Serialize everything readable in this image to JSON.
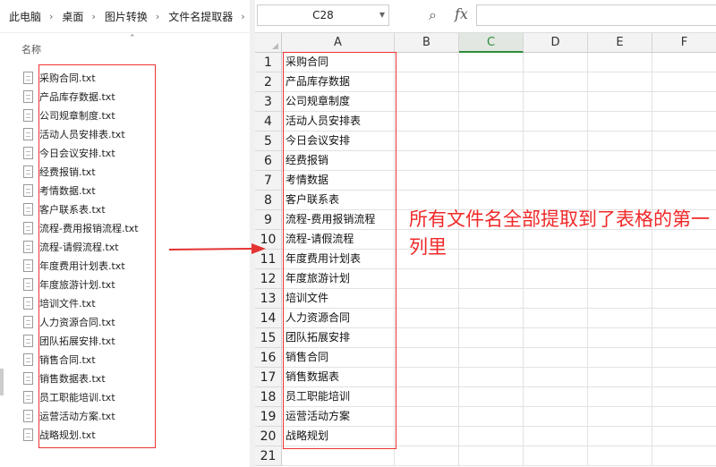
{
  "explorer": {
    "breadcrumb": [
      "此电脑",
      "桌面",
      "图片转换",
      "文件名提取器"
    ],
    "column_header": "名称",
    "files": [
      "采购合同.txt",
      "产品库存数据.txt",
      "公司规章制度.txt",
      "活动人员安排表.txt",
      "今日会议安排.txt",
      "经费报销.txt",
      "考情数据.txt",
      "客户联系表.txt",
      "流程-费用报销流程.txt",
      "流程-请假流程.txt",
      "年度费用计划表.txt",
      "年度旅游计划.txt",
      "培训文件.txt",
      "人力资源合同.txt",
      "团队拓展安排.txt",
      "销售合同.txt",
      "销售数据表.txt",
      "员工职能培训.txt",
      "运营活动方案.txt",
      "战略规划.txt"
    ]
  },
  "sheet": {
    "name_box": "C28",
    "fx_label": "fx",
    "columns": [
      "A",
      "B",
      "C",
      "D",
      "E",
      "F"
    ],
    "active_column": "C",
    "row_numbers": [
      "1",
      "2",
      "3",
      "4",
      "5",
      "6",
      "7",
      "8",
      "9",
      "10",
      "11",
      "12",
      "13",
      "14",
      "15",
      "16",
      "17",
      "18",
      "19",
      "20",
      "21"
    ],
    "column_a": [
      "采购合同",
      "产品库存数据",
      "公司规章制度",
      "活动人员安排表",
      "今日会议安排",
      "经费报销",
      "考情数据",
      "客户联系表",
      "流程-费用报销流程",
      "流程-请假流程",
      "年度费用计划表",
      "年度旅游计划",
      "培训文件",
      "人力资源合同",
      "团队拓展安排",
      "销售合同",
      "销售数据表",
      "员工职能培训",
      "运营活动方案",
      "战略规划",
      ""
    ]
  },
  "annotation": "所有文件名全部提取到了表格的第一列里",
  "colors": {
    "highlight": "#e33333",
    "active_column": "#2e8b3a"
  }
}
